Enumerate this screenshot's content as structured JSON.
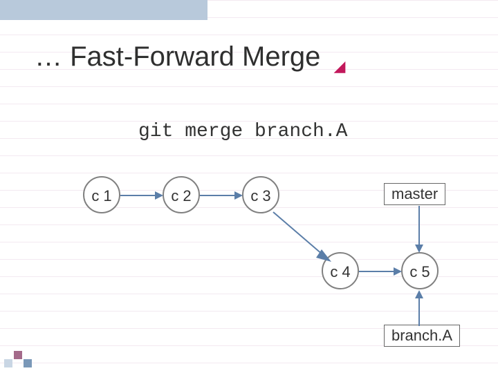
{
  "title": "… Fast-Forward Merge",
  "command": "git merge branch.A",
  "commits": {
    "c1": "c 1",
    "c2": "c 2",
    "c3": "c 3",
    "c4": "c 4",
    "c5": "c 5"
  },
  "branches": {
    "master": "master",
    "branchA": "branch.A"
  },
  "chart_data": {
    "type": "diagram",
    "title": "Fast-Forward Merge",
    "nodes": [
      {
        "id": "c1",
        "label": "c 1",
        "x": 0,
        "y": 0
      },
      {
        "id": "c2",
        "label": "c 2",
        "x": 1,
        "y": 0
      },
      {
        "id": "c3",
        "label": "c 3",
        "x": 2,
        "y": 0
      },
      {
        "id": "c4",
        "label": "c 4",
        "x": 3,
        "y": 1
      },
      {
        "id": "c5",
        "label": "c 5",
        "x": 4,
        "y": 1
      }
    ],
    "edges": [
      {
        "from": "c1",
        "to": "c2"
      },
      {
        "from": "c2",
        "to": "c3"
      },
      {
        "from": "c3",
        "to": "c4"
      },
      {
        "from": "c4",
        "to": "c5"
      }
    ],
    "refs": [
      {
        "name": "master",
        "points_to": "c5",
        "side": "above"
      },
      {
        "name": "branch.A",
        "points_to": "c5",
        "side": "below"
      }
    ]
  }
}
